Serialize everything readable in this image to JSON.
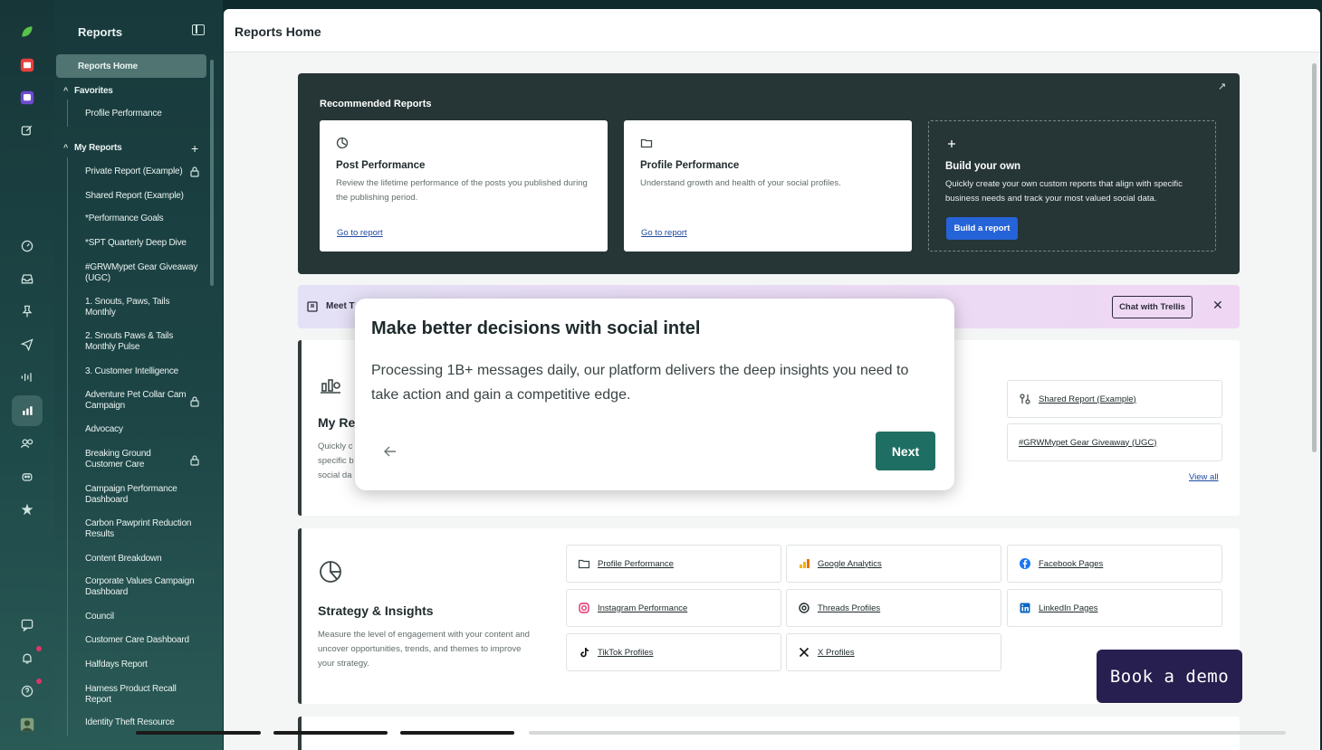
{
  "sidebar": {
    "title": "Reports",
    "home_label": "Reports Home",
    "favorites_label": "Favorites",
    "favorites": [
      "Profile Performance"
    ],
    "my_reports_label": "My Reports",
    "my_reports": [
      "Private Report (Example)",
      "Shared Report (Example)",
      "*Performance Goals",
      "*SPT Quarterly Deep Dive",
      "#GRWMypet Gear Giveaway (UGC)",
      "1. Snouts, Paws, Tails Monthly",
      "2. Snouts Paws & Tails Monthly Pulse",
      "3. Customer Intelligence",
      "Adventure Pet Collar Cam Campaign",
      "Advocacy",
      "Breaking Ground Customer Care",
      "Campaign Performance Dashboard",
      "Carbon Pawprint Reduction Results",
      "Content Breakdown",
      "Corporate Values Campaign Dashboard",
      "Council",
      "Customer Care Dashboard",
      "Halfdays Report",
      "Harness Product Recall Report",
      "Identity Theft Resource"
    ]
  },
  "header": {
    "title": "Reports Home"
  },
  "recommended": {
    "title": "Recommended Reports",
    "cards": [
      {
        "title": "Post Performance",
        "desc": "Review the lifetime performance of the posts you published during the publishing period.",
        "link": "Go to report"
      },
      {
        "title": "Profile Performance",
        "desc": "Understand growth and health of your social profiles.",
        "link": "Go to report"
      },
      {
        "title": "Build your own",
        "desc": "Quickly create your own custom reports that align with specific business needs and track your most valued social data.",
        "button": "Build a report"
      }
    ]
  },
  "banner": {
    "text": "Meet T",
    "button": "Chat with Trellis"
  },
  "my_reports_section": {
    "title": "My Re",
    "desc": "Quickly c specific b social da",
    "links": [
      "Shared Report (Example)",
      "#GRWMypet Gear Giveaway (UGC)"
    ],
    "view_all": "View all"
  },
  "strategy": {
    "title": "Strategy & Insights",
    "desc": "Measure the level of engagement with your content and uncover opportunities, trends, and themes to improve your strategy.",
    "links": [
      {
        "label": "Profile Performance",
        "icon": "folder-icon"
      },
      {
        "label": "Google Analytics",
        "icon": "google-analytics-icon"
      },
      {
        "label": "Facebook Pages",
        "icon": "facebook-icon"
      },
      {
        "label": "Instagram Performance",
        "icon": "instagram-icon"
      },
      {
        "label": "Threads Profiles",
        "icon": "threads-icon"
      },
      {
        "label": "LinkedIn Pages",
        "icon": "linkedin-icon"
      },
      {
        "label": "TikTok Profiles",
        "icon": "tiktok-icon"
      },
      {
        "label": "X Profiles",
        "icon": "x-icon"
      }
    ]
  },
  "popover": {
    "title": "Make better decisions with social intel",
    "body": "Processing 1B+ messages daily, our platform delivers the deep insights you need to take action and gain a competitive edge.",
    "next": "Next"
  },
  "demo_button": "Book a demo",
  "colors": {
    "accent_green": "#1f6e63",
    "build_blue": "#2563d8",
    "demo_purple": "#261f4f"
  }
}
